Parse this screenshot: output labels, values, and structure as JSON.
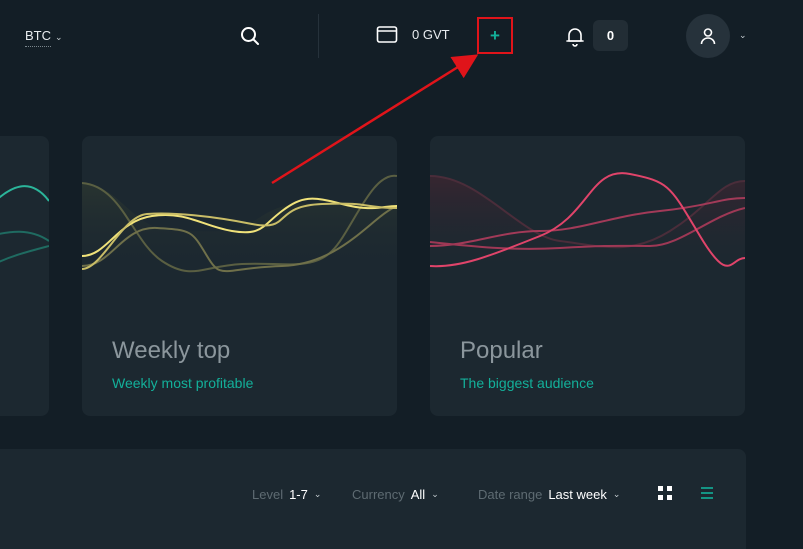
{
  "header": {
    "currency": "BTC",
    "wallet_value": "0 GVT",
    "add_label": "+",
    "notifications_count": "0"
  },
  "cards": [
    {
      "title": "Weekly top",
      "subtitle": "Weekly most profitable"
    },
    {
      "title": "Popular",
      "subtitle": "The biggest audience"
    }
  ],
  "filters": {
    "level_label": "Level",
    "level_value": "1-7",
    "currency_label": "Currency",
    "currency_value": "All",
    "date_label": "Date range",
    "date_value": "Last week"
  },
  "colors": {
    "accent": "#13b09a",
    "highlight": "#e0141a",
    "weekly_line": "#f0e27a",
    "popular_line": "#e0446a"
  },
  "icons": [
    "search-icon",
    "wallet-icon",
    "bell-icon",
    "user-icon",
    "grid-view-icon",
    "list-view-icon",
    "chevron-down-icon"
  ]
}
